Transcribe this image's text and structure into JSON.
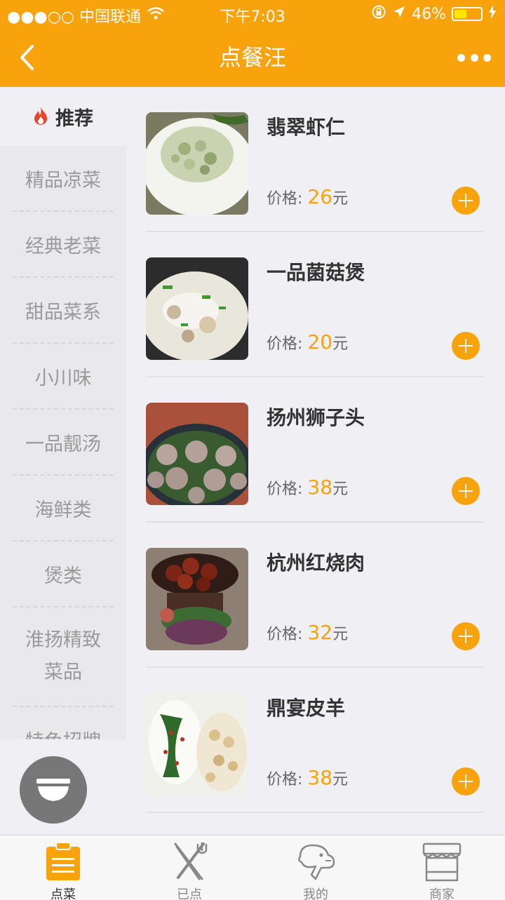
{
  "status_bar": {
    "carrier": "●●●○○ 中国联通",
    "time": "下午7:03",
    "battery": "46%",
    "battery_level": 0.46
  },
  "nav": {
    "title": "点餐汪"
  },
  "sidebar": {
    "recommend_label": "推荐",
    "items": [
      {
        "label": "精品凉菜"
      },
      {
        "label": "经典老菜"
      },
      {
        "label": "甜品菜系"
      },
      {
        "label": "小川味"
      },
      {
        "label": "一品靓汤"
      },
      {
        "label": "海鲜类"
      },
      {
        "label": "煲类"
      },
      {
        "label": "淮扬精致菜品"
      },
      {
        "label": "特色招牌"
      }
    ]
  },
  "menu": {
    "price_prefix": "价格:",
    "currency": "元",
    "dishes": [
      {
        "name": "翡翠虾仁",
        "price": "26"
      },
      {
        "name": "一品菌菇煲",
        "price": "20"
      },
      {
        "name": "扬州狮子头",
        "price": "38"
      },
      {
        "name": "杭州红烧肉",
        "price": "32"
      },
      {
        "name": "鼎宴皮羊",
        "price": "38"
      }
    ]
  },
  "tabs": [
    {
      "label": "点菜",
      "active": true
    },
    {
      "label": "已点",
      "active": false
    },
    {
      "label": "我的",
      "active": false
    },
    {
      "label": "商家",
      "active": false
    }
  ],
  "colors": {
    "accent": "#f9a30c",
    "price": "#f9a30c"
  }
}
